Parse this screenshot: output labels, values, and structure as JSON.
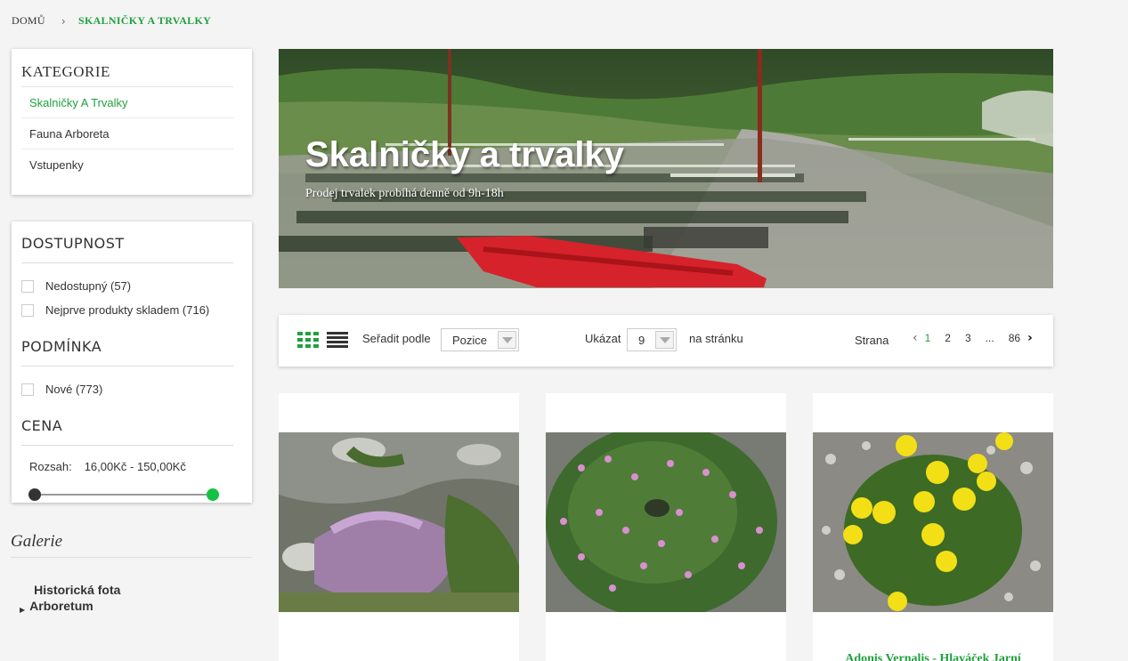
{
  "breadcrumb": {
    "home": "DOMŮ",
    "separator": "›",
    "current": "SKALNIČKY A TRVALKY"
  },
  "categories": {
    "title": "KATEGORIE",
    "items": [
      {
        "label": "Skalničky A Trvalky",
        "active": true
      },
      {
        "label": "Fauna Arboreta",
        "active": false
      },
      {
        "label": "Vstupenky",
        "active": false
      }
    ]
  },
  "filters": {
    "availability": {
      "title": "DOSTUPNOST",
      "options": [
        "Nedostupný (57)",
        "Nejprve produkty skladem (716)"
      ]
    },
    "condition": {
      "title": "PODMÍNKA",
      "options": [
        "Nové (773)"
      ]
    },
    "price": {
      "title": "CENA",
      "range_label": "Rozsah:",
      "range_value": "16,00Kč - 150,00Kč",
      "min": 16,
      "max": 150,
      "selected_min": 16,
      "selected_max": 150
    }
  },
  "gallery": {
    "title": "Galerie",
    "link": "Historická fota Arboretum",
    "link_line1": "Historická fota",
    "link_line2": "Arboretum"
  },
  "banner": {
    "title": "Skalničky a trvalky",
    "subtitle": "Prodej trvalek probíhá denně od 9h-18h"
  },
  "toolbar": {
    "sort_label": "Seřadit podle",
    "sort_value": "Pozice",
    "show_label": "Ukázat",
    "limit_value": "9",
    "per_page": "na stránku",
    "page_label": "Strana",
    "pages": [
      "1",
      "2",
      "3",
      "...",
      "86"
    ],
    "current_page": "1"
  },
  "products": [
    {
      "name": ""
    },
    {
      "name": ""
    },
    {
      "name": "Adonis Vernalis - Hlaváček Jarní"
    }
  ],
  "colors": {
    "accent": "#20a03f",
    "slider_max": "#15c143",
    "cart_red": "#d6222a"
  },
  "icons": {
    "grid": "grid-view-icon",
    "list": "list-view-icon",
    "prev": "chevron-left-icon",
    "next": "chevron-right-icon"
  }
}
